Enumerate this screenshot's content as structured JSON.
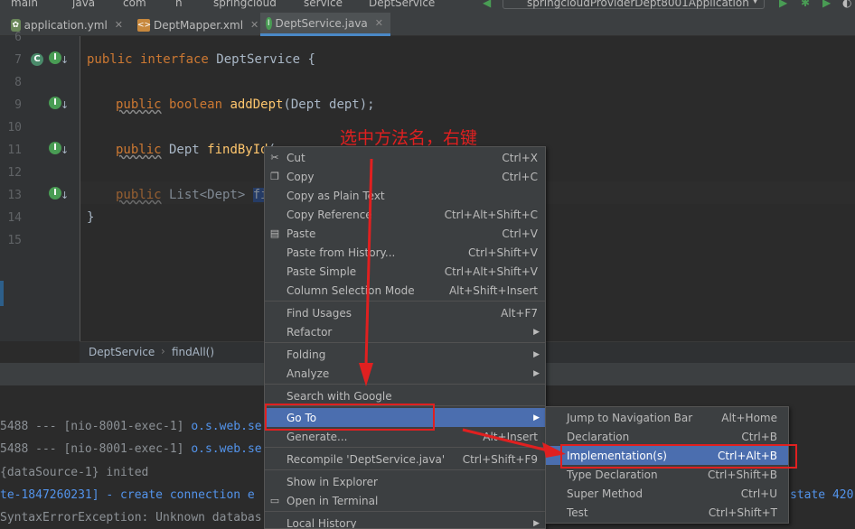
{
  "topbar": {
    "crumbs": [
      "main",
      "java",
      "com",
      "h",
      "springcloud",
      "service",
      "DeptService"
    ],
    "run_config": "springcloudProviderDept8001Application"
  },
  "tabs": [
    {
      "label": "application.yml",
      "icon": "spring-leaf-icon"
    },
    {
      "label": "DeptMapper.xml",
      "icon": "xml-file-icon"
    },
    {
      "label": "DeptService.java",
      "icon": "interface-file-icon",
      "active": true
    }
  ],
  "editor": {
    "line_numbers": [
      "6",
      "7",
      "8",
      "9",
      "10",
      "11",
      "12",
      "13",
      "14",
      "15"
    ],
    "lines": {
      "l7_kw": "public interface ",
      "l7_name": "DeptService {",
      "l9_kw1": "public",
      "l9_kw2": " boolean ",
      "l9_fn": "addDept",
      "l9_rest": "(Dept dept);",
      "l11_kw": "public",
      "l11_type": " Dept ",
      "l11_fn": "findById",
      "l11_rest": "(",
      "l13_kw": "public",
      "l13_type": " List<Dept> ",
      "l13_sel": "fin",
      "l14": "}"
    }
  },
  "annotation": "选中方法名，右键",
  "breadcrumb": {
    "items": [
      "DeptService",
      "findAll()"
    ]
  },
  "context_menu": {
    "items": [
      {
        "label": "Cut",
        "shortcut": "Ctrl+X"
      },
      {
        "label": "Copy",
        "shortcut": "Ctrl+C"
      },
      {
        "label": "Copy as Plain Text",
        "shortcut": ""
      },
      {
        "label": "Copy Reference",
        "shortcut": "Ctrl+Alt+Shift+C"
      },
      {
        "label": "Paste",
        "shortcut": "Ctrl+V"
      },
      {
        "label": "Paste from History...",
        "shortcut": "Ctrl+Shift+V"
      },
      {
        "label": "Paste Simple",
        "shortcut": "Ctrl+Alt+Shift+V"
      },
      {
        "label": "Column Selection Mode",
        "shortcut": "Alt+Shift+Insert"
      },
      {
        "label": "Find Usages",
        "shortcut": "Alt+F7"
      },
      {
        "label": "Refactor",
        "shortcut": ""
      },
      {
        "label": "Folding",
        "shortcut": ""
      },
      {
        "label": "Analyze",
        "shortcut": ""
      },
      {
        "label": "Search with Google",
        "shortcut": ""
      },
      {
        "label": "Go To",
        "shortcut": ""
      },
      {
        "label": "Generate...",
        "shortcut": "Alt+Insert"
      },
      {
        "label": "Recompile 'DeptService.java'",
        "shortcut": "Ctrl+Shift+F9"
      },
      {
        "label": "Show in Explorer",
        "shortcut": ""
      },
      {
        "label": "Open in Terminal",
        "shortcut": ""
      },
      {
        "label": "Local History",
        "shortcut": ""
      }
    ]
  },
  "goto_submenu": {
    "items": [
      {
        "label": "Jump to Navigation Bar",
        "shortcut": "Alt+Home"
      },
      {
        "label": "Declaration",
        "shortcut": "Ctrl+B"
      },
      {
        "label": "Implementation(s)",
        "shortcut": "Ctrl+Alt+B"
      },
      {
        "label": "Type Declaration",
        "shortcut": "Ctrl+Shift+B"
      },
      {
        "label": "Super Method",
        "shortcut": "Ctrl+U"
      },
      {
        "label": "Test",
        "shortcut": "Ctrl+Shift+T"
      }
    ]
  },
  "console": {
    "lines": [
      {
        "a": "5488 --- [nio-8001-exec-1] ",
        "b": "o.s.web.se"
      },
      {
        "a": "5488 --- [nio-8001-exec-1] ",
        "b": "o.s.web.se"
      },
      {
        "a": "{dataSource-1} inited",
        "b": ""
      },
      {
        "a": "te-1847260231] - create connection e",
        "b": ""
      },
      {
        "a": "SyntaxErrorException: Unknown databas",
        "b": ""
      }
    ],
    "right_text": "state 420"
  },
  "colors": {
    "accent_selection": "#4b6eaf",
    "annotation_red": "#e02020",
    "keyword": "#cc7832",
    "function": "#ffc66d"
  }
}
